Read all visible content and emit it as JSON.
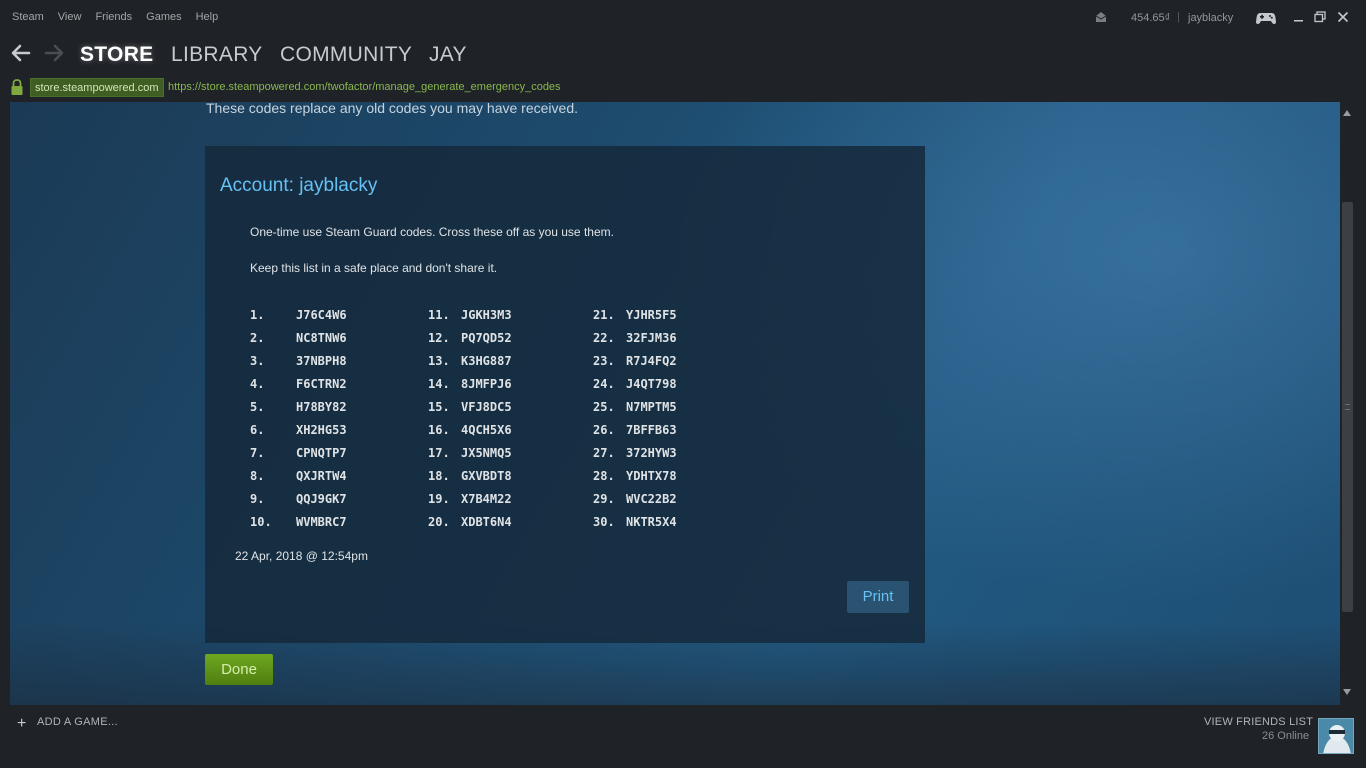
{
  "menu": [
    "Steam",
    "View",
    "Friends",
    "Games",
    "Help"
  ],
  "account": {
    "wallet": "454.65₫",
    "separator": "|",
    "username": "jayblacky"
  },
  "nav": {
    "store": "STORE",
    "library": "LIBRARY",
    "community": "COMMUNITY",
    "user": "JAY"
  },
  "url": {
    "domain": "store.steampowered.com",
    "full": "https://store.steampowered.com/twofactor/manage_generate_emergency_codes"
  },
  "page": {
    "replace_note": "These codes replace any old codes you may have received.",
    "account_title": "Account: jayblacky",
    "desc1": "One-time use Steam Guard codes. Cross these off as you use them.",
    "desc2": "Keep this list in a safe place and don't share it.",
    "timestamp": "22 Apr, 2018 @ 12:54pm",
    "print_label": "Print",
    "done_label": "Done"
  },
  "codes": [
    {
      "n": "1.",
      "c": "J76C4W6"
    },
    {
      "n": "2.",
      "c": "NC8TNW6"
    },
    {
      "n": "3.",
      "c": "37NBPH8"
    },
    {
      "n": "4.",
      "c": "F6CTRN2"
    },
    {
      "n": "5.",
      "c": "H78BY82"
    },
    {
      "n": "6.",
      "c": "XH2HG53"
    },
    {
      "n": "7.",
      "c": "CPNQTP7"
    },
    {
      "n": "8.",
      "c": "QXJRTW4"
    },
    {
      "n": "9.",
      "c": "QQJ9GK7"
    },
    {
      "n": "10.",
      "c": "WVMBRC7"
    },
    {
      "n": "11.",
      "c": "JGKH3M3"
    },
    {
      "n": "12.",
      "c": "PQ7QD52"
    },
    {
      "n": "13.",
      "c": "K3HG887"
    },
    {
      "n": "14.",
      "c": "8JMFPJ6"
    },
    {
      "n": "15.",
      "c": "VFJ8DC5"
    },
    {
      "n": "16.",
      "c": "4QCH5X6"
    },
    {
      "n": "17.",
      "c": "JX5NMQ5"
    },
    {
      "n": "18.",
      "c": "GXVBDT8"
    },
    {
      "n": "19.",
      "c": "X7B4M22"
    },
    {
      "n": "20.",
      "c": "XDBT6N4"
    },
    {
      "n": "21.",
      "c": "YJHR5F5"
    },
    {
      "n": "22.",
      "c": "32FJM36"
    },
    {
      "n": "23.",
      "c": "R7J4FQ2"
    },
    {
      "n": "24.",
      "c": "J4QT798"
    },
    {
      "n": "25.",
      "c": "N7MPTM5"
    },
    {
      "n": "26.",
      "c": "7BFFB63"
    },
    {
      "n": "27.",
      "c": "372HYW3"
    },
    {
      "n": "28.",
      "c": "YDHTX78"
    },
    {
      "n": "29.",
      "c": "WVC22B2"
    },
    {
      "n": "30.",
      "c": "NKTR5X4"
    }
  ],
  "bottom": {
    "add_plus": "+",
    "add_game": "ADD A GAME...",
    "friends": "VIEW FRIENDS LIST",
    "online": "26 Online"
  },
  "icons": [
    "notification-icon",
    "controller-icon",
    "minimize-icon",
    "maximize-icon",
    "close-icon",
    "back-arrow-icon",
    "forward-arrow-icon",
    "lock-icon"
  ],
  "colors": {
    "accent": "#66c0f4",
    "done_green": "#5c8d14",
    "url_green": "#89b84f"
  }
}
